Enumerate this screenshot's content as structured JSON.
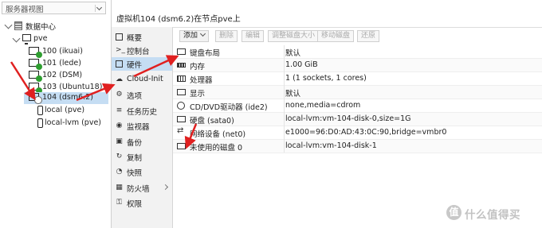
{
  "tree": {
    "view_select": "服务器视图",
    "datacenter": "数据中心",
    "node": "pve",
    "vms": [
      {
        "label": "100 (ikuai)",
        "running": true
      },
      {
        "label": "101 (lede)",
        "running": true
      },
      {
        "label": "102 (DSM)",
        "running": true
      },
      {
        "label": "103 (Ubuntu18)",
        "running": true
      },
      {
        "label": "104 (dsm6.2)",
        "running": false
      }
    ],
    "storages": [
      "local (pve)",
      "local-lvm (pve)"
    ]
  },
  "header": {
    "title": "虚拟机104 (dsm6.2)在节点pve上"
  },
  "menu": [
    {
      "label": "概要",
      "icon": "summary-icon"
    },
    {
      "label": "控制台",
      "icon": "console-icon"
    },
    {
      "label": "硬件",
      "icon": "hardware-icon",
      "active": true
    },
    {
      "label": "Cloud-Init",
      "icon": "cloud-icon"
    },
    {
      "label": "选项",
      "icon": "options-icon"
    },
    {
      "label": "任务历史",
      "icon": "task-history-icon"
    },
    {
      "label": "监视器",
      "icon": "monitor-icon"
    },
    {
      "label": "备份",
      "icon": "backup-icon"
    },
    {
      "label": "复制",
      "icon": "replication-icon"
    },
    {
      "label": "快照",
      "icon": "snapshot-icon"
    },
    {
      "label": "防火墙",
      "icon": "firewall-icon"
    },
    {
      "label": "权限",
      "icon": "permissions-icon"
    }
  ],
  "toolbar": {
    "add": "添加",
    "remove": "删除",
    "edit": "编辑",
    "resize": "调整磁盘大小",
    "move": "移动磁盘",
    "revert": "还原"
  },
  "hardware": [
    {
      "key": "键盘布局",
      "value": "默认",
      "icon": "keyboard-icon"
    },
    {
      "key": "内存",
      "value": "1.00 GiB",
      "icon": "memory-icon"
    },
    {
      "key": "处理器",
      "value": "1 (1 sockets, 1 cores)",
      "icon": "cpu-icon"
    },
    {
      "key": "显示",
      "value": "默认",
      "icon": "display-icon"
    },
    {
      "key": "CD/DVD驱动器 (ide2)",
      "value": "none,media=cdrom",
      "icon": "cdrom-icon"
    },
    {
      "key": "硬盘 (sata0)",
      "value": "local-lvm:vm-104-disk-0,size=1G",
      "icon": "harddisk-icon"
    },
    {
      "key": "网络设备 (net0)",
      "value": "e1000=96:D0:AD:43:0C:90,bridge=vmbr0",
      "icon": "network-icon"
    },
    {
      "key": "未使用的磁盘 0",
      "value": "local-lvm:vm-104-disk-1",
      "icon": "unused-disk-icon"
    }
  ],
  "watermark": "值 什么值得买",
  "colors": {
    "selected_bg": "#c5ddf3",
    "arrow": "#e02020",
    "running": "#2e9e30"
  }
}
